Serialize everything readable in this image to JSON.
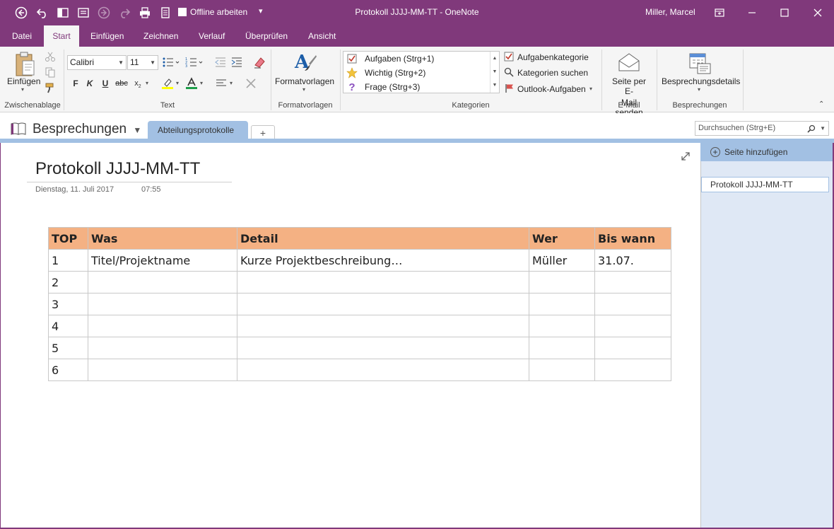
{
  "titlebar": {
    "offline_label": "Offline arbeiten",
    "window_title": "Protokoll JJJJ-MM-TT  -  OneNote",
    "user_name": "Miller, Marcel"
  },
  "tabs": [
    "Datei",
    "Start",
    "Einfügen",
    "Zeichnen",
    "Verlauf",
    "Überprüfen",
    "Ansicht"
  ],
  "active_tab": "Start",
  "ribbon": {
    "clipboard": {
      "paste_label": "Einfügen",
      "group_label": "Zwischenablage"
    },
    "text": {
      "font_name": "Calibri",
      "font_size": "11",
      "bold": "F",
      "italic": "K",
      "underline": "U",
      "strike": "abc",
      "subscript": "x",
      "group_label": "Text"
    },
    "styles": {
      "label": "Formatvorlagen",
      "group_label": "Formatvorlagen"
    },
    "tags": {
      "items": [
        {
          "label": "Aufgaben (Strg+1)"
        },
        {
          "label": "Wichtig (Strg+2)"
        },
        {
          "label": "Frage (Strg+3)"
        }
      ],
      "todo_tag": "Aufgabenkategorie",
      "find_tags": "Kategorien suchen",
      "outlook_tasks": "Outlook-Aufgaben",
      "group_label": "Kategorien"
    },
    "email": {
      "label_line1": "Seite per E-",
      "label_line2": "Mail senden",
      "group_label": "E-Mail"
    },
    "meetings": {
      "label": "Besprechungsdetails",
      "group_label": "Besprechungen"
    }
  },
  "notebook": {
    "name": "Besprechungen",
    "section_tab": "Abteilungsprotokolle",
    "add_tab": "+",
    "search_placeholder": "Durchsuchen (Strg+E)"
  },
  "page": {
    "title": "Protokoll JJJJ-MM-TT",
    "date": "Dienstag, 11. Juli 2017",
    "time": "07:55"
  },
  "table": {
    "headers": [
      "TOP",
      "Was",
      "Detail",
      "Wer",
      "Bis wann"
    ],
    "rows": [
      [
        "1",
        "Titel/Projektname",
        "Kurze Projektbeschreibung…",
        "Müller",
        "31.07."
      ],
      [
        "2",
        "",
        "",
        "",
        ""
      ],
      [
        "3",
        "",
        "",
        "",
        ""
      ],
      [
        "4",
        "",
        "",
        "",
        ""
      ],
      [
        "5",
        "",
        "",
        "",
        ""
      ],
      [
        "6",
        "",
        "",
        "",
        ""
      ]
    ]
  },
  "pages_pane": {
    "add_page": "Seite hinzufügen",
    "pages": [
      "Protokoll JJJJ-MM-TT"
    ]
  },
  "colors": {
    "accent": "#80397B",
    "section_blue": "#A2C0E3",
    "pane_bg": "#DFE8F5",
    "table_header": "#F4B183"
  }
}
